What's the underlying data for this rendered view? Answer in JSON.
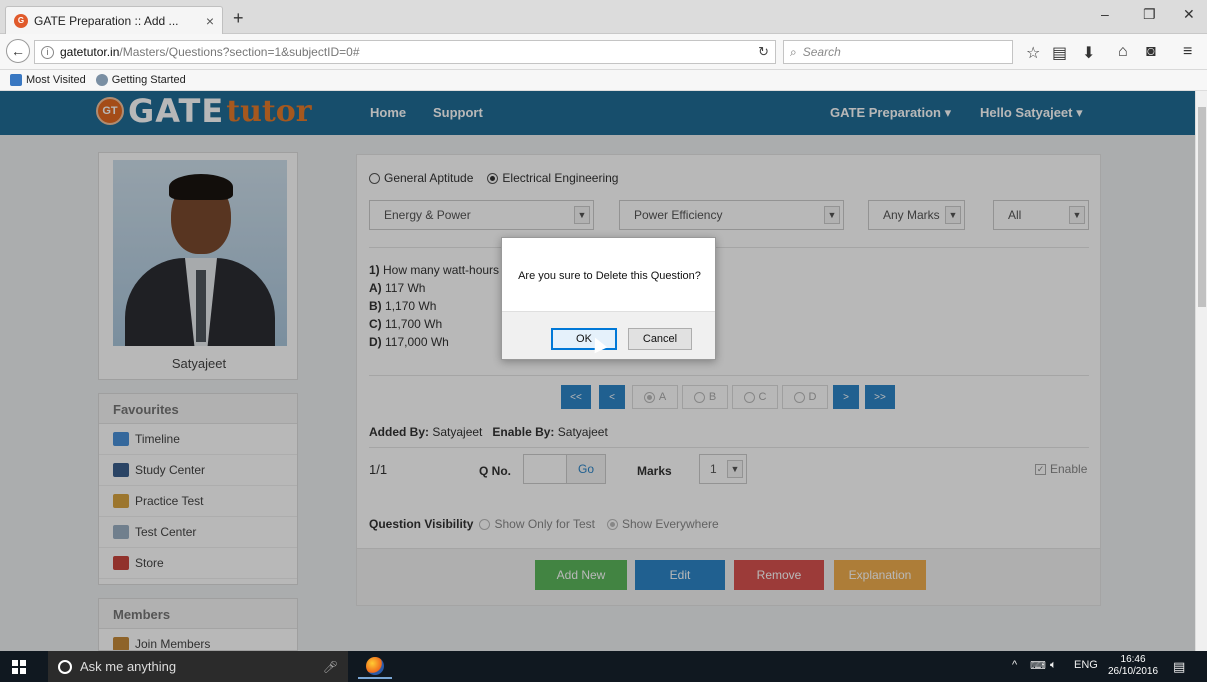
{
  "browser": {
    "tab_title": "GATE Preparation :: Add ...",
    "tab_close": "×",
    "new_tab": "+",
    "url_host": "gatetutor.in",
    "url_path": "/Masters/Questions?section=1&subjectID=0#",
    "search_placeholder": "Search",
    "bookmarks": [
      "Most Visited",
      "Getting Started"
    ],
    "window_controls": [
      "–",
      "❐",
      "✕"
    ]
  },
  "site": {
    "logo_gt": "GT",
    "logo_gate": "GATE",
    "logo_tutor": "tutor",
    "nav": [
      "Home",
      "Support"
    ],
    "menu_preparation": "GATE Preparation ▾",
    "menu_user": "Hello Satyajeet ▾"
  },
  "profile": {
    "name": "Satyajeet"
  },
  "favourites": {
    "title": "Favourites",
    "items": [
      "Timeline",
      "Study Center",
      "Practice Test",
      "Test Center",
      "Store"
    ]
  },
  "members": {
    "title": "Members",
    "items": [
      "Join Members"
    ]
  },
  "filters": {
    "sections": [
      "General Aptitude",
      "Electrical Engineering"
    ],
    "selected_section": "Electrical Engineering",
    "topic": "Energy & Power",
    "subtopic": "Power Efficiency",
    "marks_filter": "Any Marks",
    "type_filter": "All"
  },
  "question": {
    "number": "1)",
    "text": "How many watt-hours",
    "options": [
      {
        "label": "A)",
        "text": "117 Wh"
      },
      {
        "label": "B)",
        "text": "1,170 Wh"
      },
      {
        "label": "C)",
        "text": "11,700 Wh"
      },
      {
        "label": "D)",
        "text": "117,000 Wh"
      }
    ]
  },
  "answer_nav": {
    "first": "<<",
    "prev": "<",
    "next": ">",
    "last": ">>",
    "answers": [
      "A",
      "B",
      "C",
      "D"
    ],
    "selected": "A"
  },
  "meta": {
    "added_by_label": "Added By:",
    "added_by": "Satyajeet",
    "enable_by_label": "Enable By:",
    "enable_by": "Satyajeet"
  },
  "qnav": {
    "position": "1/1",
    "qno_label": "Q No.",
    "go_label": "Go",
    "marks_label": "Marks",
    "marks_value": "1",
    "enable_label": "Enable"
  },
  "visibility": {
    "label": "Question Visibility",
    "options": [
      "Show Only for Test",
      "Show Everywhere"
    ],
    "selected": "Show Everywhere"
  },
  "actions": {
    "add_new": "Add New",
    "edit": "Edit",
    "remove": "Remove",
    "explanation": "Explanation",
    "colors": {
      "add_new": "#5cb85c",
      "edit": "#2d85c8",
      "remove": "#d9534f",
      "explanation": "#f0ad4e"
    }
  },
  "dialog": {
    "message": "Are you sure to Delete this Question?",
    "ok": "OK",
    "cancel": "Cancel"
  },
  "taskbar": {
    "search_placeholder": "Ask me anything",
    "tray_lang": "ENG",
    "time": "16:46",
    "date": "26/10/2016"
  }
}
